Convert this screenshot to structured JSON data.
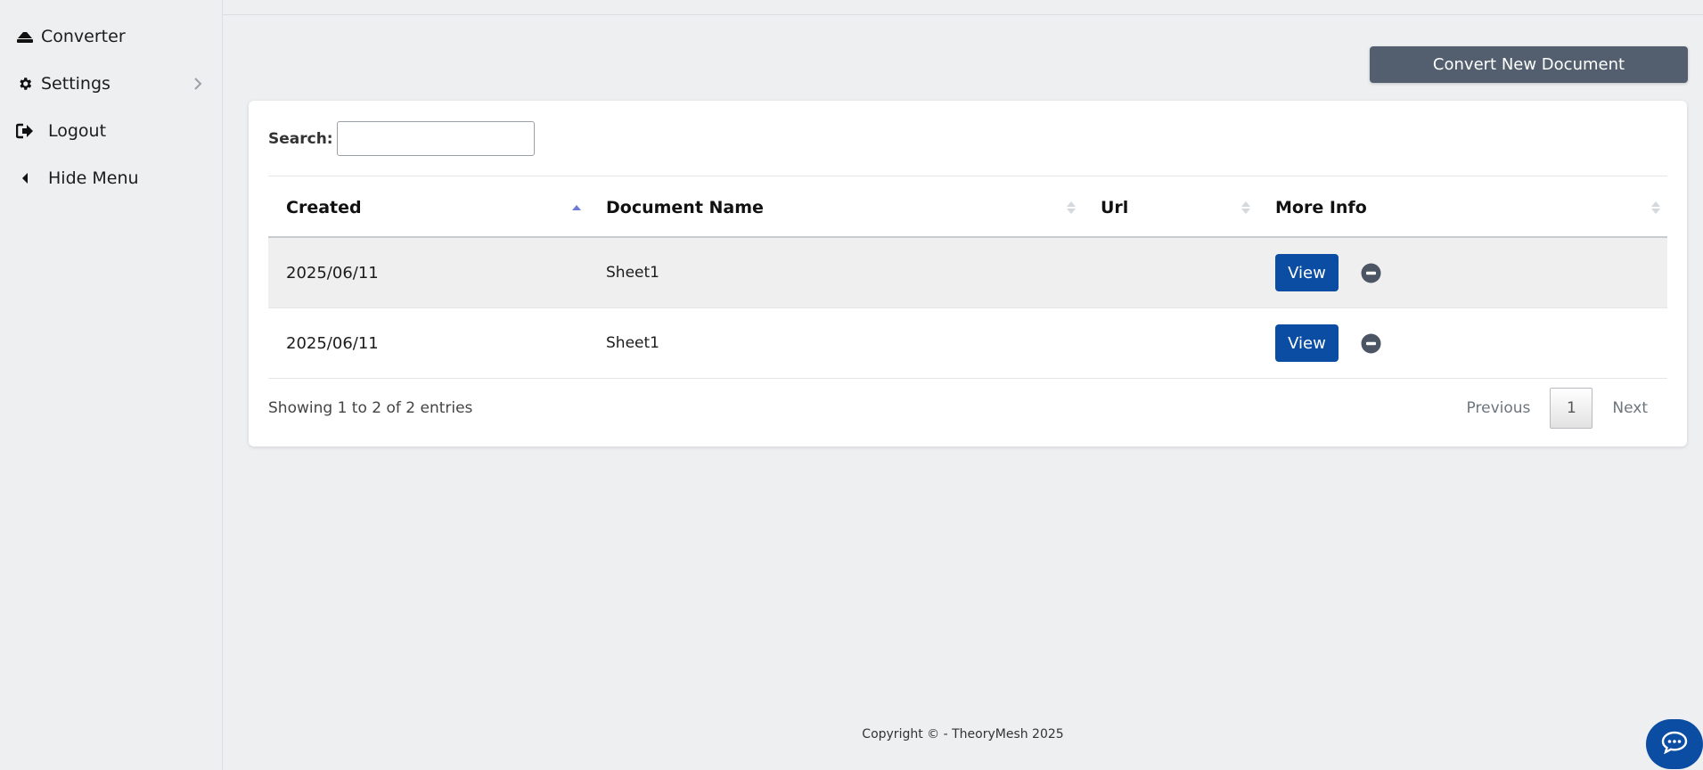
{
  "sidebar": {
    "items": [
      {
        "label": "Converter",
        "icon": "eraser-icon"
      },
      {
        "label": "Settings",
        "icon": "gear-icon",
        "has_submenu": true
      },
      {
        "label": "Logout",
        "icon": "logout-icon"
      },
      {
        "label": "Hide Menu",
        "icon": "caret-left-icon"
      }
    ]
  },
  "toolbar": {
    "convert_label": "Convert New Document"
  },
  "search": {
    "label": "Search:",
    "value": "",
    "placeholder": ""
  },
  "table": {
    "columns": [
      "Created",
      "Document Name",
      "Url",
      "More Info"
    ],
    "sorted_column": "Created",
    "sort_direction": "asc",
    "rows": [
      {
        "created": "2025/06/11",
        "name": "Sheet1",
        "url": "",
        "action": "View"
      },
      {
        "created": "2025/06/11",
        "name": "Sheet1",
        "url": "",
        "action": "View"
      }
    ],
    "info": "Showing 1 to 2 of 2 entries"
  },
  "pagination": {
    "previous": "Previous",
    "current": "1",
    "next": "Next"
  },
  "footer": {
    "copyright": "Copyright © - TheoryMesh 2025"
  },
  "colors": {
    "primary": "#0b4da2",
    "secondary": "#535f6e",
    "background": "#eeeff1"
  }
}
